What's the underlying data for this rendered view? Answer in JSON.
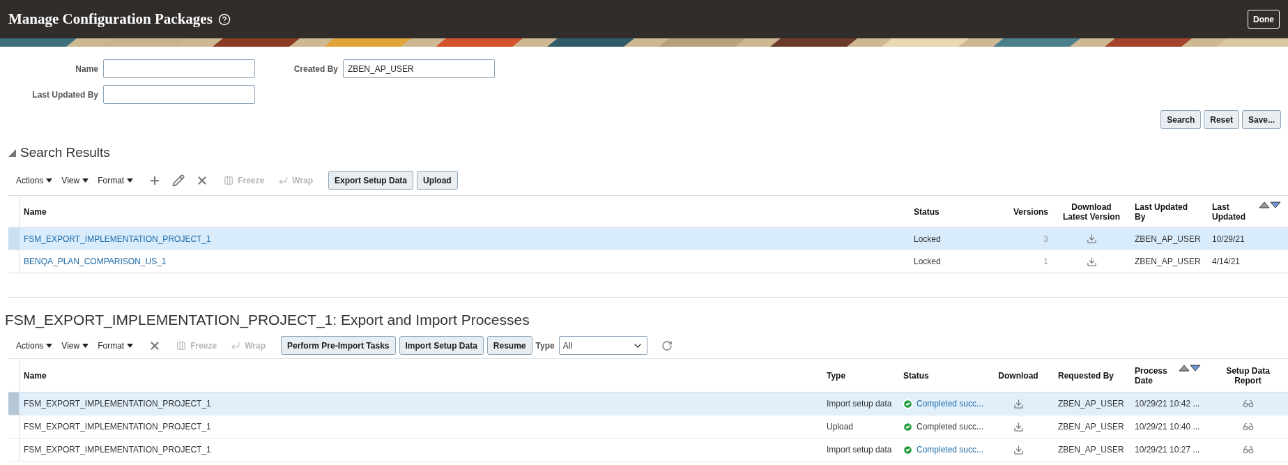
{
  "header": {
    "title": "Manage Configuration Packages",
    "done_button": "Done"
  },
  "search": {
    "fields": [
      {
        "label": "Name"
      },
      {
        "label": "Created By",
        "value": "ZBEN_AP_USER"
      },
      {
        "label": "Last Updated By"
      }
    ],
    "buttons": [
      "Search",
      "Reset",
      "Save..."
    ]
  },
  "results": {
    "title": "Search Results",
    "expanded": true,
    "toolbar": {
      "menus": [
        "Actions",
        "View",
        "Format"
      ],
      "icon_tools": [
        {
          "kind": "add"
        },
        {
          "kind": "edit"
        },
        {
          "kind": "delete"
        }
      ],
      "text_tools": [
        {
          "kind": "freeze",
          "label": "Freeze",
          "disabled": true
        },
        {
          "kind": "wrap",
          "label": "Wrap",
          "disabled": true
        }
      ],
      "buttons": [
        "Export Setup Data",
        "Upload"
      ]
    },
    "table": {
      "columns": [
        {
          "label": "Name"
        },
        {
          "label": "Status"
        },
        {
          "label": "Versions"
        },
        {
          "label": "Download Latest Version"
        },
        {
          "label": "Last Updated By"
        },
        {
          "label": "Last Updated",
          "sortable": true
        }
      ],
      "rows": [
        {
          "name": "FSM_EXPORT_IMPLEMENTATION_PROJECT_1",
          "status": "Locked",
          "versions": "3",
          "last_updated_by": "ZBEN_AP_USER",
          "last_updated": "10/29/21",
          "selected": true
        },
        {
          "name": "BENQA_PLAN_COMPARISON_US_1",
          "status": "Locked",
          "versions": "1",
          "last_updated_by": "ZBEN_AP_USER",
          "last_updated": "4/14/21",
          "selected": false
        }
      ]
    }
  },
  "processes": {
    "title": "FSM_EXPORT_IMPLEMENTATION_PROJECT_1: Export and Import Processes",
    "toolbar": {
      "menus": [
        "Actions",
        "View",
        "Format"
      ],
      "icon_tools": [
        {
          "kind": "delete"
        }
      ],
      "text_tools": [
        {
          "kind": "freeze",
          "label": "Freeze",
          "disabled": true
        },
        {
          "kind": "wrap",
          "label": "Wrap",
          "disabled": true
        }
      ],
      "buttons": [
        "Perform Pre-Import Tasks",
        "Import Setup Data",
        "Resume"
      ],
      "type_filter": {
        "label": "Type",
        "value": "All"
      }
    },
    "table": {
      "columns": [
        {
          "label": "Name"
        },
        {
          "label": "Type"
        },
        {
          "label": "Status"
        },
        {
          "label": "Download"
        },
        {
          "label": "Requested By"
        },
        {
          "label": "Process Date",
          "sortable": true
        },
        {
          "label": "Setup Data Report"
        }
      ],
      "rows": [
        {
          "name": "FSM_EXPORT_IMPLEMENTATION_PROJECT_1",
          "type": "Import setup data",
          "status": {
            "text": "Completed succ...",
            "kind": "success",
            "link": true
          },
          "requested_by": "ZBEN_AP_USER",
          "process_date": "10/29/21 10:42 ...",
          "selected": true
        },
        {
          "name": "FSM_EXPORT_IMPLEMENTATION_PROJECT_1",
          "type": "Upload",
          "status": {
            "text": "Completed succ...",
            "kind": "success",
            "link": false
          },
          "requested_by": "ZBEN_AP_USER",
          "process_date": "10/29/21 10:40 ...",
          "selected": false
        },
        {
          "name": "FSM_EXPORT_IMPLEMENTATION_PROJECT_1",
          "type": "Import setup data",
          "status": {
            "text": "Completed succ...",
            "kind": "success",
            "link": true
          },
          "requested_by": "ZBEN_AP_USER",
          "process_date": "10/29/21 10:27 ...",
          "selected": false
        }
      ]
    }
  }
}
